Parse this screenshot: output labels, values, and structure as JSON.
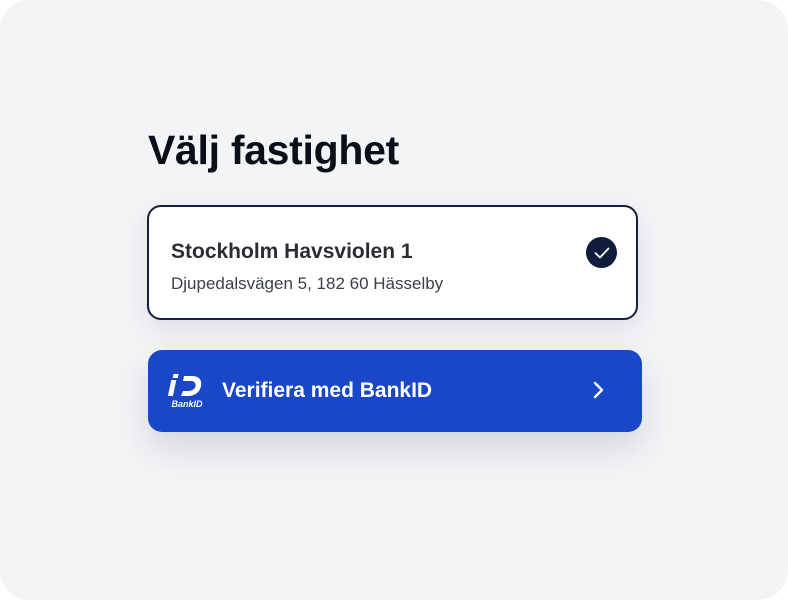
{
  "page": {
    "title": "Välj fastighet"
  },
  "property": {
    "name": "Stockholm Havsviolen 1",
    "address": "Djupedalsvägen 5, 182 60 Hässelby",
    "selected": true,
    "check_icon": "check-circle-icon"
  },
  "bankid_button": {
    "label": "Verifiera med BankID",
    "logo_text": "BankID",
    "logo_icon": "bankid-logo-icon",
    "arrow_icon": "chevron-right-icon"
  },
  "colors": {
    "background": "#f3f4f6",
    "card_border": "#13203f",
    "check_fill": "#0f1c3e",
    "bankid_blue": "#1a47c7",
    "title_text": "#0b0f1a"
  }
}
